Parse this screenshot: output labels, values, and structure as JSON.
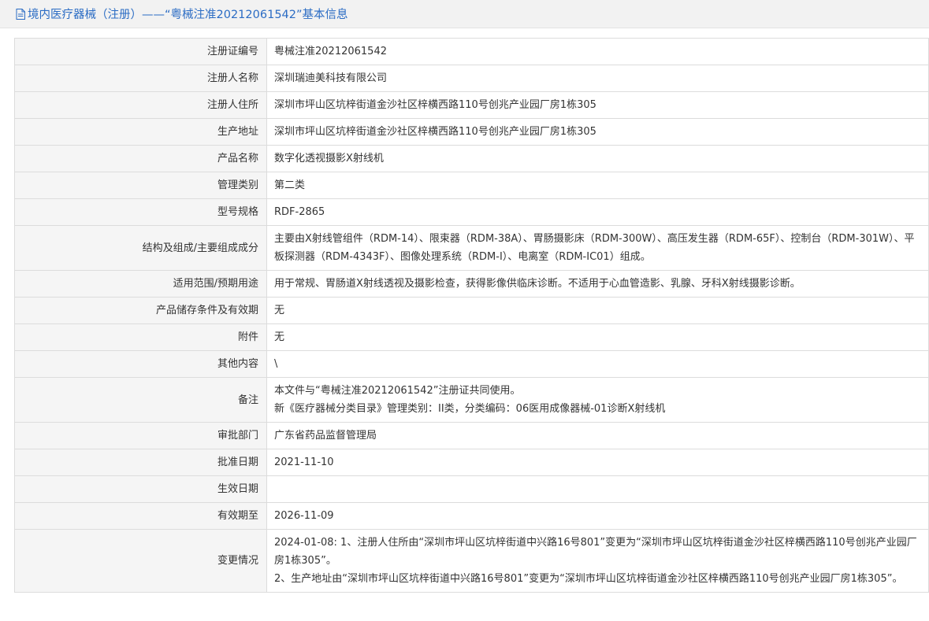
{
  "header": {
    "title": "境内医疗器械（注册）——“粤械注准20212061542”基本信息",
    "icon": "document-icon"
  },
  "rows": [
    {
      "label": "注册证编号",
      "value": "粤械注准20212061542"
    },
    {
      "label": "注册人名称",
      "value": "深圳瑞迪美科技有限公司"
    },
    {
      "label": "注册人住所",
      "value": "深圳市坪山区坑梓街道金沙社区梓横西路110号创兆产业园厂房1栋305"
    },
    {
      "label": "生产地址",
      "value": "深圳市坪山区坑梓街道金沙社区梓横西路110号创兆产业园厂房1栋305"
    },
    {
      "label": "产品名称",
      "value": "数字化透视摄影X射线机"
    },
    {
      "label": "管理类别",
      "value": "第二类"
    },
    {
      "label": "型号规格",
      "value": "RDF-2865"
    },
    {
      "label": "结构及组成/主要组成成分",
      "value": "主要由X射线管组件（RDM-14）、限束器（RDM-38A）、胃肠摄影床（RDM-300W）、高压发生器（RDM-65F）、控制台（RDM-301W）、平板探测器（RDM-4343F）、图像处理系统（RDM-I）、电离室（RDM-IC01）组成。"
    },
    {
      "label": "适用范围/预期用途",
      "value": "用于常规、胃肠道X射线透视及摄影检查，获得影像供临床诊断。不适用于心血管造影、乳腺、牙科X射线摄影诊断。"
    },
    {
      "label": "产品储存条件及有效期",
      "value": "无"
    },
    {
      "label": "附件",
      "value": "无"
    },
    {
      "label": "其他内容",
      "value": "\\"
    },
    {
      "label": "备注",
      "lines": [
        "本文件与“粤械注准20212061542”注册证共同使用。",
        "新《医疗器械分类目录》管理类别：II类，分类编码：06医用成像器械-01诊断X射线机"
      ]
    },
    {
      "label": "审批部门",
      "value": "广东省药品监督管理局"
    },
    {
      "label": "批准日期",
      "value": "2021-11-10"
    },
    {
      "label": "生效日期",
      "value": ""
    },
    {
      "label": "有效期至",
      "value": "2026-11-09"
    },
    {
      "label": "变更情况",
      "lines": [
        "2024-01-08: 1、注册人住所由“深圳市坪山区坑梓街道中兴路16号801”变更为“深圳市坪山区坑梓街道金沙社区梓横西路110号创兆产业园厂房1栋305”。",
        "2、生产地址由“深圳市坪山区坑梓街道中兴路16号801”变更为“深圳市坪山区坑梓街道金沙社区梓横西路110号创兆产业园厂房1栋305”。"
      ]
    }
  ]
}
